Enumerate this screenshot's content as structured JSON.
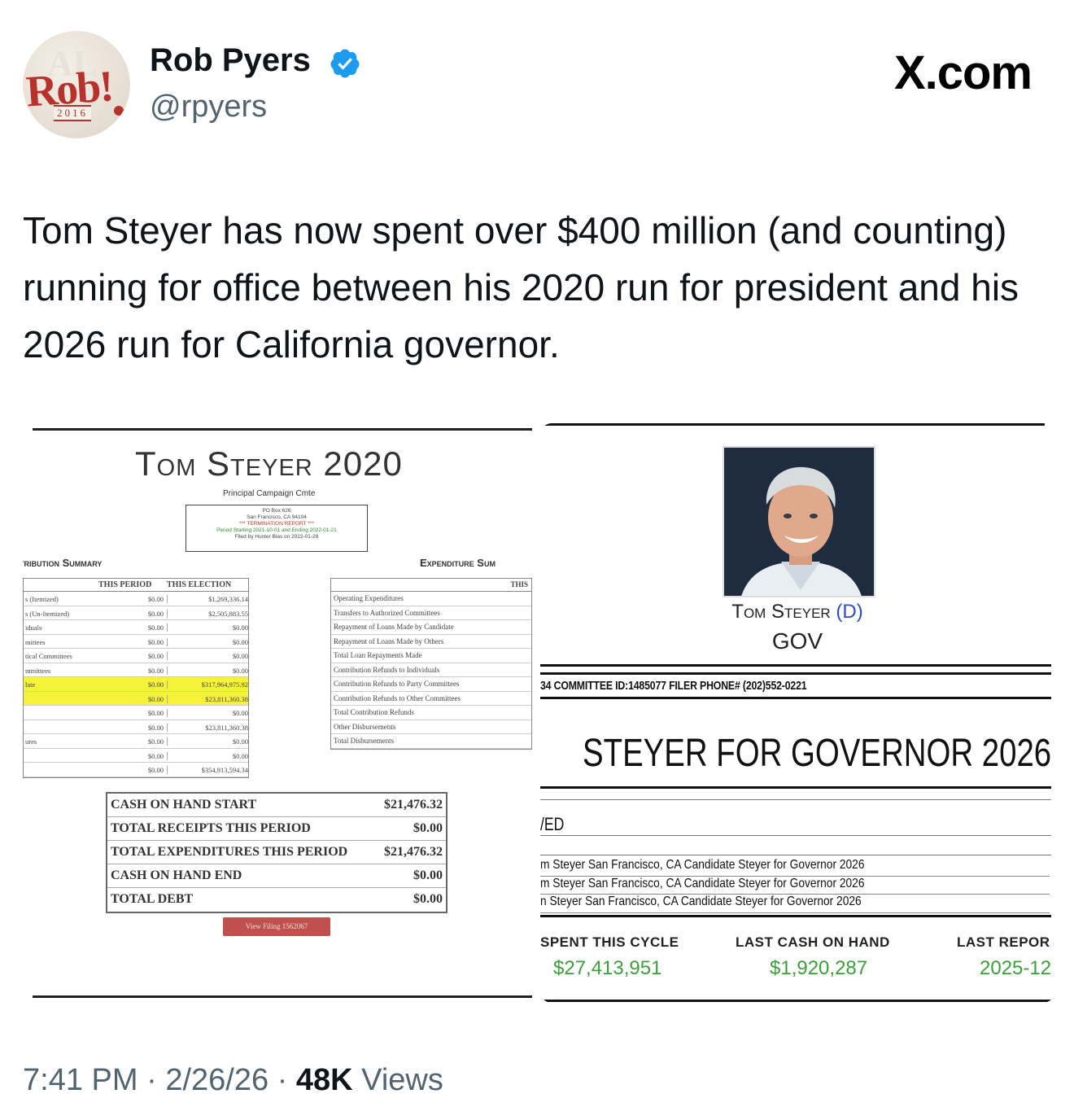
{
  "author": {
    "name": "Rob Pyers",
    "handle": "@rpyers",
    "avatar_text": "Rob!",
    "avatar_year": "2016"
  },
  "brand": "X.com",
  "tweet_text": "Tom Steyer has now spent over $400 million (and counting) running for office between his 2020 run for president and his 2026 run for California governor.",
  "left_image": {
    "title": "Tom Steyer 2020",
    "subtitle": "Principal Campaign Cmte",
    "box_lines": [
      "PO Box 626",
      "San Francisco, CA 94104",
      "*** TERMINATION REPORT ***",
      "Period Starting 2021-10-01 and Ending 2022-01-21",
      "Filed by Hunter Blas on 2022-01-28"
    ],
    "section_left": "tribution Summary",
    "section_right": "Expenditure Sum",
    "left_table": {
      "headers": [
        "THIS PERIOD",
        "THIS ELECTION"
      ],
      "rows": [
        {
          "label": "s (Itemized)",
          "period": "$0.00",
          "election": "$1,269,336.14",
          "hl": false
        },
        {
          "label": "s (Un-Itemized)",
          "period": "$0.00",
          "election": "$2,505,883.55",
          "hl": false
        },
        {
          "label": "iduals",
          "period": "$0.00",
          "election": "$0.00",
          "hl": false
        },
        {
          "label": "mittees",
          "period": "$0.00",
          "election": "$0.00",
          "hl": false
        },
        {
          "label": "tical Committees",
          "period": "$0.00",
          "election": "$0.00",
          "hl": false
        },
        {
          "label": "mmittees",
          "period": "$0.00",
          "election": "$0.00",
          "hl": false
        },
        {
          "label": "late",
          "period": "$0.00",
          "election": "$317,964,975.92",
          "hl": true
        },
        {
          "label": "",
          "period": "$0.00",
          "election": "$23,811,360.38",
          "hl": true
        },
        {
          "label": "",
          "period": "$0.00",
          "election": "$0.00",
          "hl": false
        },
        {
          "label": "",
          "period": "$0.00",
          "election": "$23,811,360.38",
          "hl": false
        },
        {
          "label": "ures",
          "period": "$0.00",
          "election": "$0.00",
          "hl": false
        },
        {
          "label": "",
          "period": "$0.00",
          "election": "$0.00",
          "hl": false
        },
        {
          "label": "",
          "period": "$0.00",
          "election": "$354,913,594.34",
          "hl": false
        }
      ]
    },
    "right_table": {
      "header": "THIS",
      "rows": [
        "Operating Expenditures",
        "Transfers to Authorized Committees",
        "Repayment of Loans Made by Candidate",
        "Repayment of Loans Made by Others",
        "Total Loan Repayments Made",
        "Contribution Refunds to Individuals",
        "Contribution Refunds to Party Committees",
        "Contribution Refunds to Other Committees",
        "Total Contribution Refunds",
        "Other Disbursements",
        "Total Disbursements"
      ]
    },
    "cash_table": [
      {
        "label": "CASH ON HAND START",
        "value": "$21,476.32"
      },
      {
        "label": "TOTAL RECEIPTS THIS PERIOD",
        "value": "$0.00"
      },
      {
        "label": "TOTAL EXPENDITURES THIS PERIOD",
        "value": "$21,476.32"
      },
      {
        "label": "CASH ON HAND END",
        "value": "$0.00"
      },
      {
        "label": "TOTAL DEBT",
        "value": "$0.00"
      }
    ],
    "view_button": "View Filing 1562067"
  },
  "right_image": {
    "name": "Tom Steyer",
    "party": "(D)",
    "office": "GOV",
    "committee_line": "34 COMMITTEE ID:1485077 FILER PHONE# (202)552-0221",
    "title": "STEYER FOR GOVERNOR 2026",
    "ed_label": "/ED",
    "rows": [
      "m Steyer San Francisco, CA Candidate Steyer for Governor 2026",
      "m Steyer San Francisco, CA Candidate Steyer for Governor 2026",
      "n Steyer San Francisco, CA Candidate Steyer for Governor 2026"
    ],
    "stats": [
      {
        "label": "SPENT THIS CYCLE",
        "value": "$27,413,951"
      },
      {
        "label": "LAST CASH ON HAND",
        "value": "$1,920,287"
      },
      {
        "label": "LAST REPOR",
        "value": "2025-12"
      }
    ]
  },
  "footer": {
    "time": "7:41 PM",
    "date": "2/26/26",
    "views_count": "48K",
    "views_label": "Views"
  },
  "colors": {
    "verified_blue": "#1d9bf0",
    "highlight_yellow": "#f6f23a",
    "money_green": "#3aa13a",
    "button_red": "#c0504d"
  }
}
